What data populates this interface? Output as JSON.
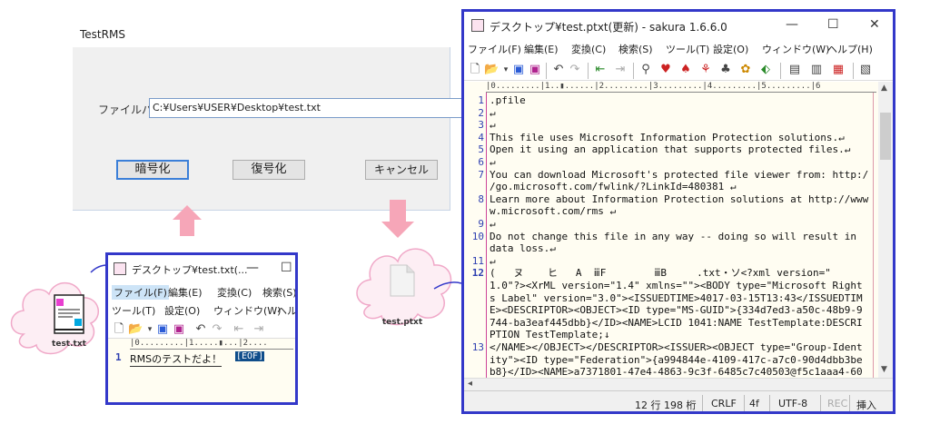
{
  "rms_dialog": {
    "title": "TestRMS",
    "path_label": "ファイルパ",
    "path_value": "C:¥Users¥USER¥Desktop¥test.txt",
    "encrypt_button": "暗号化",
    "decrypt_button": "復号化",
    "cancel_button": "キャンセル"
  },
  "small_window": {
    "title": "デスクトップ¥test.txt(...",
    "minimize": "—",
    "maximize": "☐",
    "menu_row1": [
      "ファイル(F)",
      "編集(E)",
      "変換(C)",
      "検索(S)"
    ],
    "menu_row2": [
      "ツール(T)",
      "設定(O)",
      "ウィンドウ(W)",
      "ヘル"
    ],
    "ruler": "|0.........|1.....▮...|2....",
    "line_number": "1",
    "line_text": "RMSのテストだよ！",
    "eof": "[EOF]"
  },
  "icons": {
    "txt_label": "test.txt",
    "ptxt_label": "test.ptxt"
  },
  "big_window": {
    "title": "デスクトップ¥test.ptxt(更新) - sakura 1.6.6.0",
    "minimize": "—",
    "maximize": "☐",
    "close": "✕",
    "menu": [
      "ファイル(F)",
      "編集(E)",
      "変換(C)",
      "検索(S)",
      "ツール(T)",
      "設定(O)",
      "ウィンドウ(W)",
      "ヘルプ(H)"
    ],
    "ruler": "|0.........|1..▮......|2.........|3.........|4.........|5.........|6",
    "line_numbers": [
      "1",
      "2",
      "3",
      "4",
      "5",
      "6",
      "7",
      "",
      "8",
      "",
      "9",
      "10",
      "",
      "11",
      "12",
      "",
      "",
      "",
      "",
      "",
      "13",
      "",
      ""
    ],
    "lines": [
      ".pfile",
      "↵",
      "↵",
      "This file uses Microsoft Information Protection solutions.↵",
      "Open it using an application that supports protected files.↵",
      "↵",
      "You can download Microsoft's protected file viewer from: http:/",
      "/go.microsoft.com/fwlink/?LinkId=480381 ↵",
      "Learn more about Information Protection solutions at http://www",
      "w.microsoft.com/rms ↵",
      "↵",
      "Do not change this file in any way -- doing so will result in ",
      "data loss.↵",
      "↵",
      "(   ヌ    ヒ   A  ⅲF        ⅲB     .txt・ソ<?xml version=\"",
      "1.0\"?><XrML version=\"1.4\" xmlns=\"\"><BODY type=\"Microsoft Right",
      "s Label\" version=\"3.0\"><ISSUEDTIME>4017-03-15T13:43</ISSUEDTIM",
      "E><DESCRIPTOR><OBJECT><ID type=\"MS-GUID\">{334d7ed3-a50c-48b9-9",
      "744-ba3eaf445dbb}</ID><NAME>LCID 1041:NAME TestTemplate:DESCRI",
      "PTION TestTemplate;↓",
      "</NAME></OBJECT></DESCRIPTOR><ISSUER><OBJECT type=\"Group-Ident",
      "ity\"><ID type=\"Federation\">{a994844e-4109-417c-a7c0-90d4dbb3be",
      "b8}</ID><NAME>a7371801-47e4-4863-9c3f-6485c7c40503@f5c1aaa4-60"
    ],
    "status": {
      "position": "12 行 198 桁",
      "eol": "CRLF",
      "code": "4f",
      "encoding": "UTF-8",
      "rec": "REC",
      "insert": "挿入"
    }
  },
  "colors": {
    "window_border": "#3338c9",
    "arrow": "#f6a6b8",
    "cloud_fill": "#fdeef4",
    "cloud_stroke": "#f0a8c8"
  }
}
